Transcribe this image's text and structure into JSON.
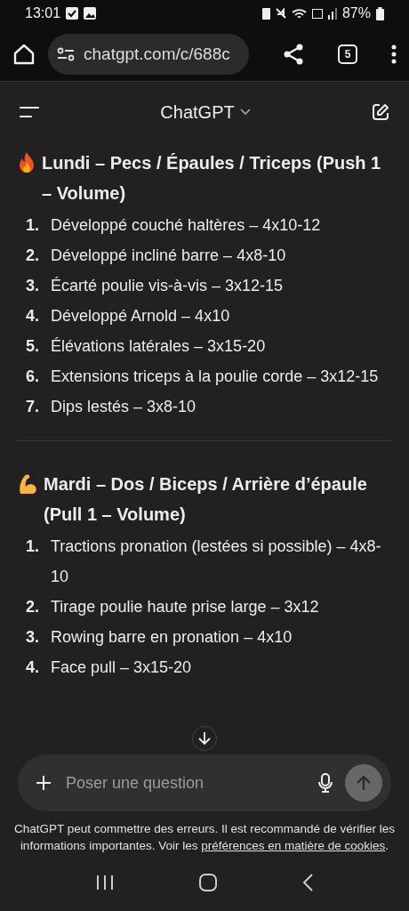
{
  "status_bar": {
    "time": "13:01",
    "battery": "87%"
  },
  "browser": {
    "url": "chatgpt.com/c/688c",
    "tab_count": "5"
  },
  "app_header": {
    "title": "ChatGPT"
  },
  "sections": [
    {
      "kind": "flame",
      "heading": "Lundi – Pecs / Épaules / Triceps (Push 1 – Volume)",
      "items": [
        {
          "number": "1.",
          "text": "Développé couché haltères – 4x10-12"
        },
        {
          "number": "2.",
          "text": "Développé incliné barre – 4x8-10"
        },
        {
          "number": "3.",
          "text": "Écarté poulie vis-à-vis – 3x12-15"
        },
        {
          "number": "4.",
          "text": "Développé Arnold – 4x10"
        },
        {
          "number": "5.",
          "text": "Élévations latérales – 3x15-20"
        },
        {
          "number": "6.",
          "text": "Extensions triceps à la poulie corde – 3x12-15"
        },
        {
          "number": "7.",
          "text": "Dips lestés – 3x8-10"
        }
      ]
    },
    {
      "kind": "arm",
      "heading": "Mardi – Dos / Biceps / Arrière d’épaule (Pull 1 – Volume)",
      "items": [
        {
          "number": "1.",
          "text": "Tractions pronation (lestées si possible) – 4x8-10"
        },
        {
          "number": "2.",
          "text": "Tirage poulie haute prise large – 3x12"
        },
        {
          "number": "3.",
          "text": "Rowing barre en pronation – 4x10"
        },
        {
          "number": "4.",
          "text": "Face pull – 3x15-20"
        }
      ]
    }
  ],
  "composer": {
    "placeholder": "Poser une question"
  },
  "disclaimer": {
    "text": "ChatGPT peut commettre des erreurs. Il est recommandé de vérifier les informations importantes. Voir les ",
    "link": "préférences en matière de cookies",
    "end": "."
  }
}
